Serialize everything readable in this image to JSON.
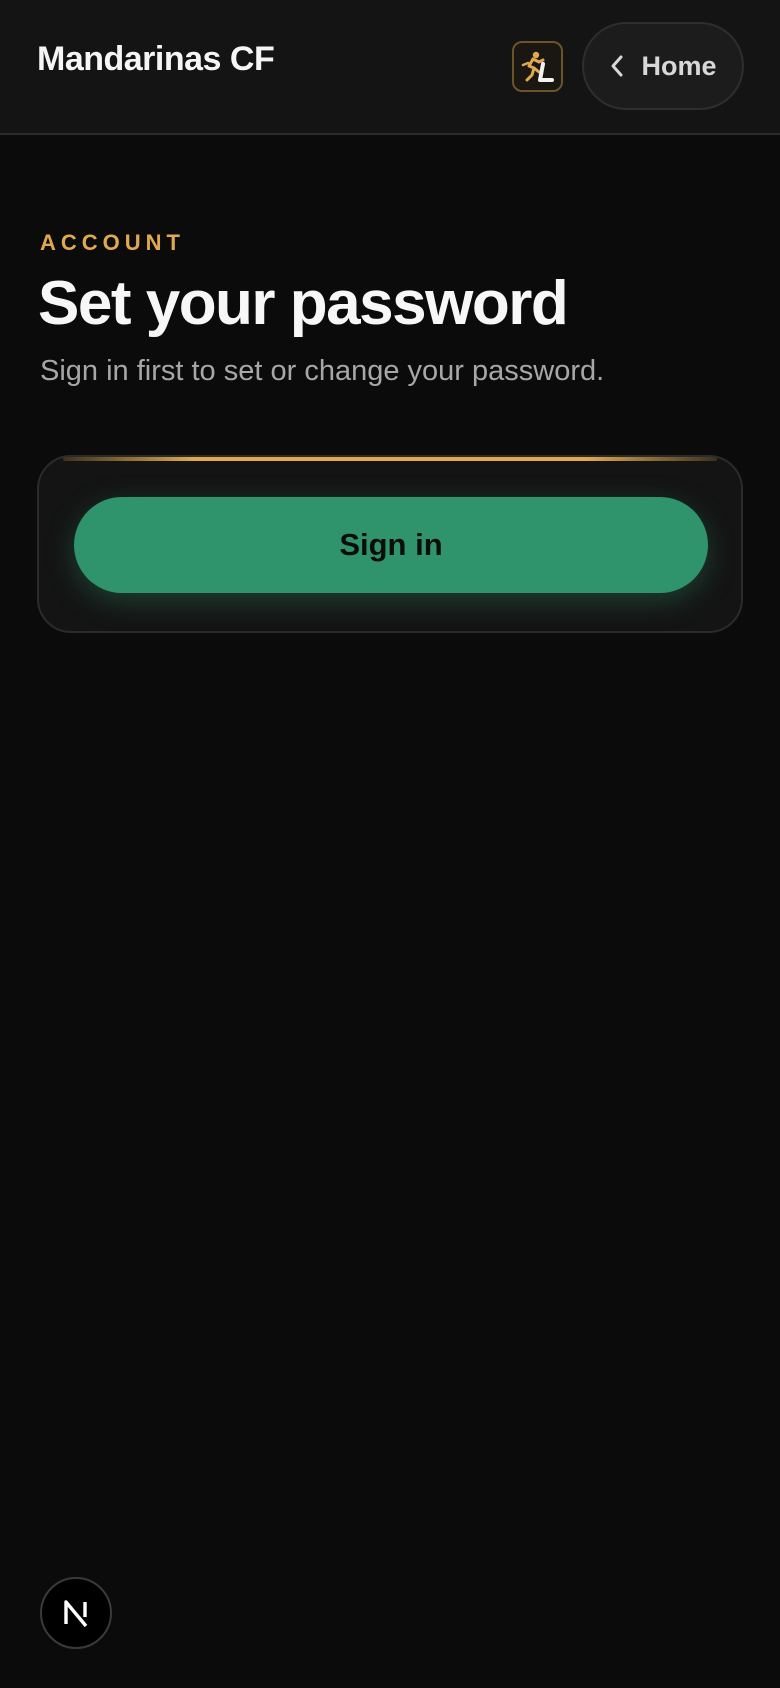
{
  "header": {
    "brand": "Mandarinas CF",
    "app_logo_icon": "runner-logo-icon",
    "home_button": {
      "label": "Home",
      "icon": "chevron-left-icon"
    }
  },
  "main": {
    "eyebrow": "ACCOUNT",
    "title": "Set your password",
    "subtitle": "Sign in first to set or change your password."
  },
  "card": {
    "signin_label": "Sign in"
  },
  "footer": {
    "badge_icon": "nextjs-icon"
  },
  "colors": {
    "accent_gold": "#e0a94f",
    "primary_green": "#2f936b",
    "background": "#0b0b0b",
    "header_bg": "#141414"
  }
}
